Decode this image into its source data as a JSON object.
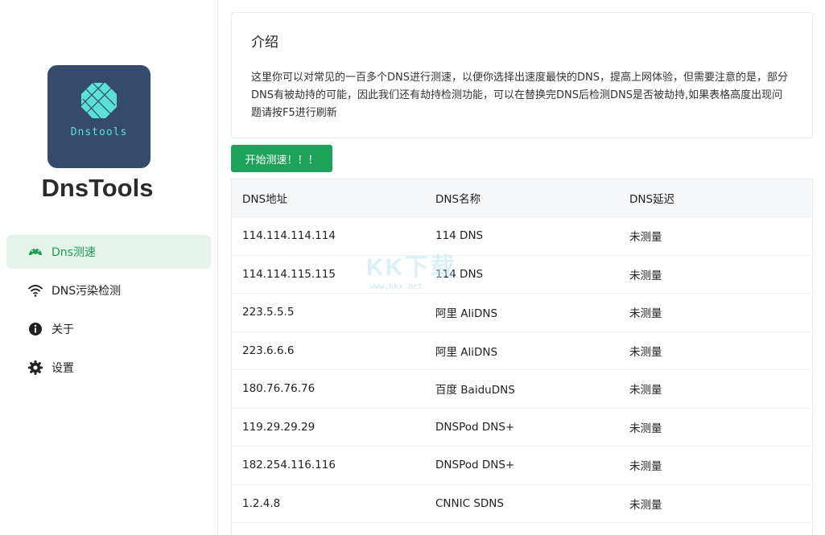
{
  "app": {
    "logo_caption": "Dnstools",
    "name": "DnsTools"
  },
  "nav": [
    {
      "label": "Dns测速",
      "icon": "speedometer-icon",
      "active": true
    },
    {
      "label": "DNS污染检测",
      "icon": "wifi-icon",
      "active": false
    },
    {
      "label": "关于",
      "icon": "info-icon",
      "active": false
    },
    {
      "label": "设置",
      "icon": "gear-icon",
      "active": false
    }
  ],
  "intro": {
    "title": "介绍",
    "text": "这里你可以对常见的一百多个DNS进行测速，以便你选择出速度最快的DNS，提高上网体验，但需要注意的是，部分DNS有被劫持的可能，因此我们还有劫持检测功能，可以在替换完DNS后检测DNS是否被劫持,如果表格高度出现问题请按F5进行刷新"
  },
  "start_button": "开始测速！！！",
  "table": {
    "headers": [
      "DNS地址",
      "DNS名称",
      "DNS延迟"
    ],
    "rows": [
      [
        "114.114.114.114",
        "114 DNS",
        "未测量"
      ],
      [
        "114.114.115.115",
        "114 DNS",
        "未测量"
      ],
      [
        "223.5.5.5",
        "阿里 AliDNS",
        "未测量"
      ],
      [
        "223.6.6.6",
        "阿里 AliDNS",
        "未测量"
      ],
      [
        "180.76.76.76",
        "百度 BaiduDNS",
        "未测量"
      ],
      [
        "119.29.29.29",
        "DNSPod DNS+",
        "未测量"
      ],
      [
        "182.254.116.116",
        "DNSPod DNS+",
        "未测量"
      ],
      [
        "1.2.4.8",
        "CNNIC SDNS",
        "未测量"
      ]
    ]
  },
  "watermark": {
    "big": "KK下载",
    "small": "www.kkx.net"
  },
  "colors": {
    "accent": "#1fa35a",
    "active_nav_bg": "#e6f3ea",
    "logo_bg": "#354b6b",
    "logo_mark": "#5ce0d8"
  }
}
